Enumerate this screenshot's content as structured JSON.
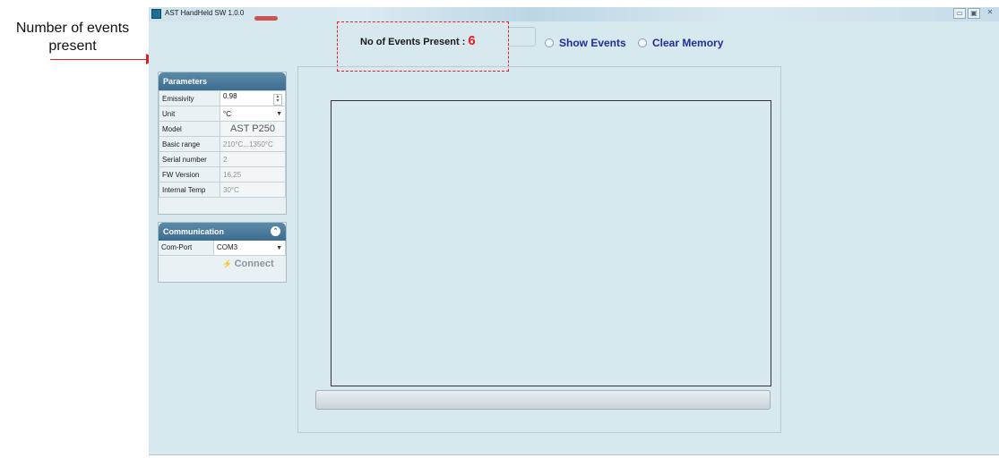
{
  "annotation": {
    "line1": "Number of events",
    "line2": "present",
    "color": "#e02020"
  },
  "window": {
    "title": "AST HandHeld SW 1.0.0",
    "controls": {
      "minimize": "▭",
      "maximize": "▣",
      "close": "✕"
    }
  },
  "events": {
    "label": "No of Events  Present :",
    "count": "6"
  },
  "options": {
    "show_events": "Show Events",
    "clear_memory": "Clear Memory"
  },
  "parameters": {
    "title": "Parameters",
    "rows": [
      {
        "label": "Emissivity",
        "value": "0.98"
      },
      {
        "label": "Unit",
        "value": "°C"
      },
      {
        "label": "Model",
        "value": "AST P250"
      },
      {
        "label": "Basic range",
        "value": "210°C...1350°C"
      },
      {
        "label": "Serial number",
        "value": "2"
      },
      {
        "label": "FW Version",
        "value": "16.25"
      },
      {
        "label": "Internal Temp",
        "value": "30°C"
      }
    ]
  },
  "communication": {
    "title": "Communication",
    "com_port_label": "Com-Port",
    "com_port_value": "COM3",
    "connect_label": "Connect"
  },
  "colors": {
    "accent": "#e81c1c",
    "link": "#1e2f9a",
    "panel_header": "#3d6d8f",
    "background": "#d7e8ee"
  }
}
